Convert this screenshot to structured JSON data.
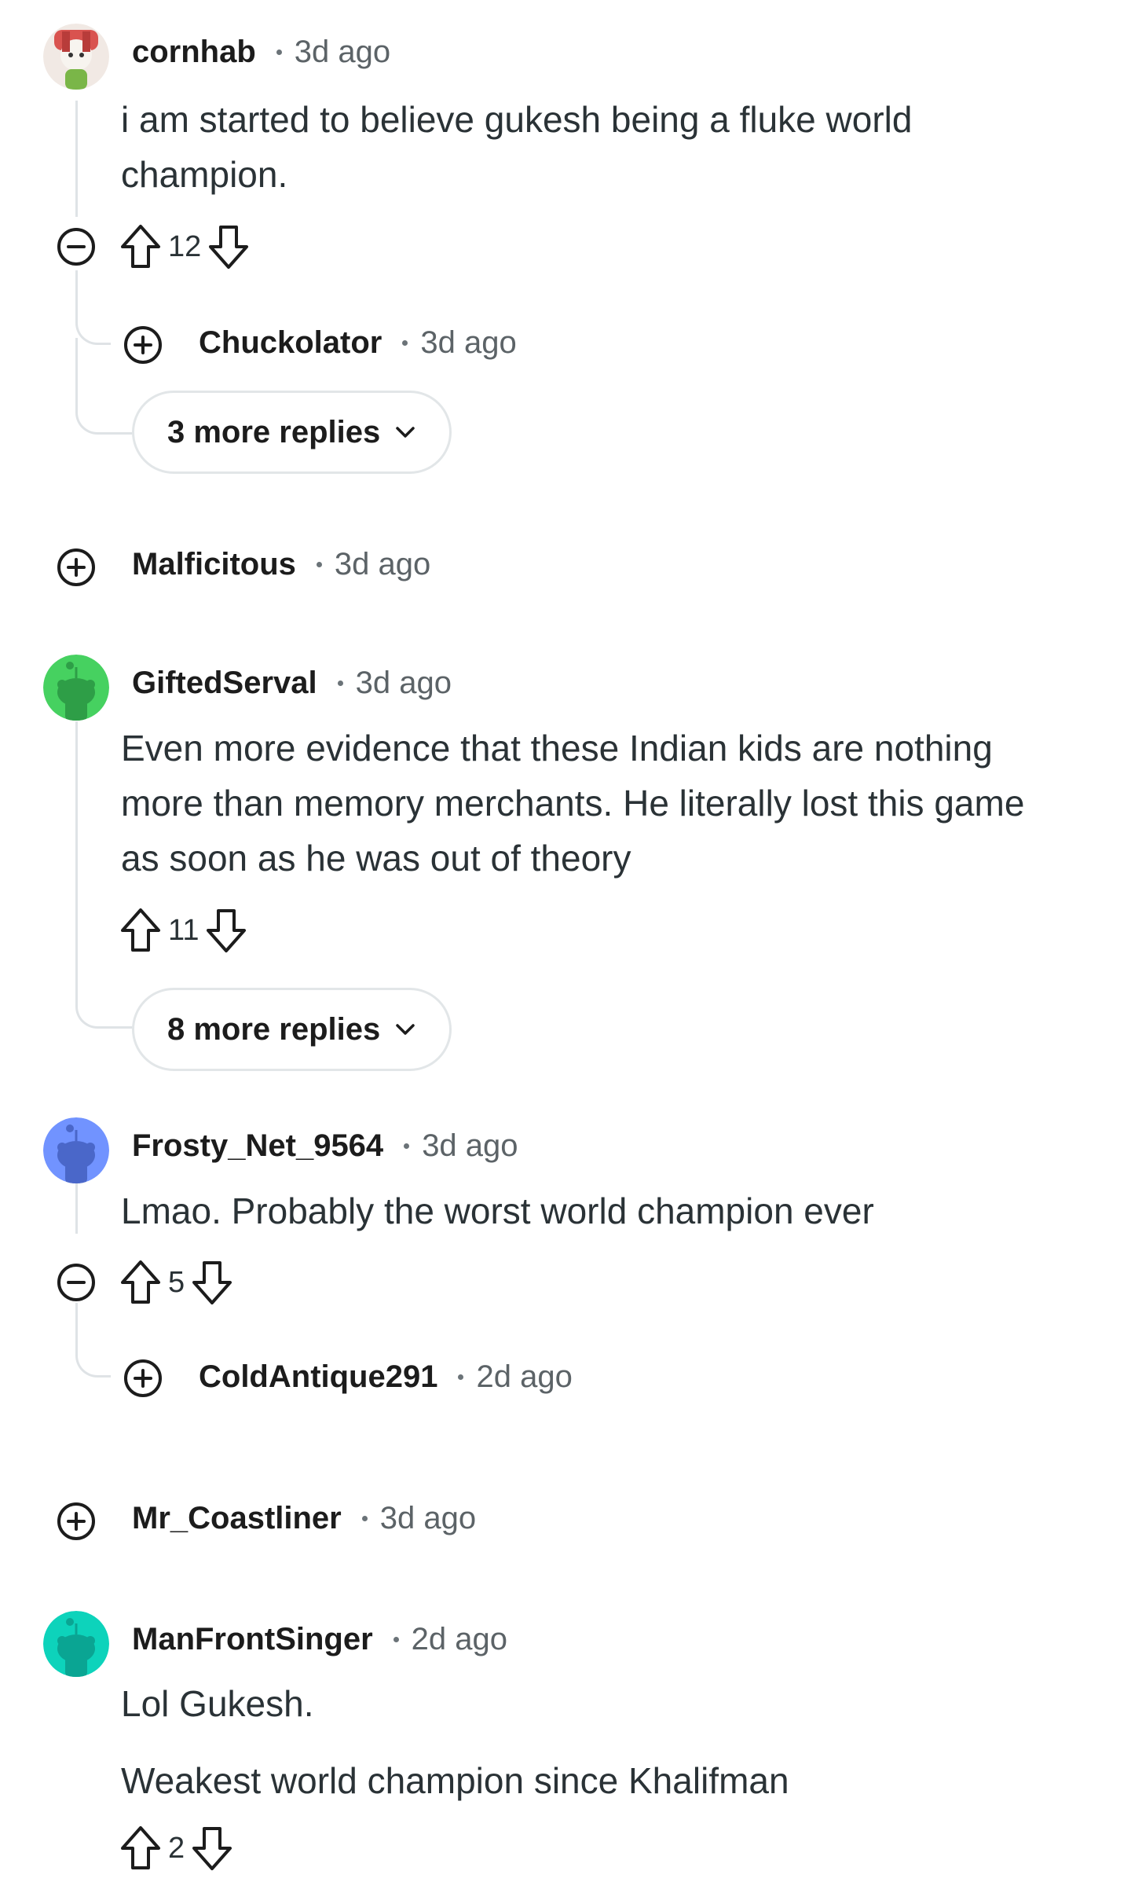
{
  "comments": [
    {
      "user": "cornhab",
      "time": "3d ago",
      "avatar_icon": "snoo-avatar-cornhab",
      "body": [
        "i am started to believe gukesh being a fluke world champion."
      ],
      "votes": "12",
      "replies": [
        {
          "user": "Chuckolator",
          "time": "3d ago",
          "collapsed": true
        }
      ],
      "more_replies_label": "3 more replies"
    },
    {
      "user": "Malficitous",
      "time": "3d ago",
      "collapsed": true
    },
    {
      "user": "GiftedServal",
      "time": "3d ago",
      "avatar_icon": "snoo-avatar-green",
      "body": [
        "Even more evidence that these Indian kids are nothing more than memory merchants. He literally lost this game as soon as he was out of theory"
      ],
      "votes": "11",
      "more_replies_label": "8 more replies"
    },
    {
      "user": "Frosty_Net_9564",
      "time": "3d ago",
      "avatar_icon": "snoo-avatar-blue",
      "body": [
        "Lmao. Probably the worst world champion ever"
      ],
      "votes": "5",
      "replies": [
        {
          "user": "ColdAntique291",
          "time": "2d ago",
          "collapsed": true
        }
      ]
    },
    {
      "user": "Mr_Coastliner",
      "time": "3d ago",
      "collapsed": true
    },
    {
      "user": "ManFrontSinger",
      "time": "2d ago",
      "avatar_icon": "snoo-avatar-teal",
      "body": [
        "Lol Gukesh.",
        "Weakest world champion since Khalifman"
      ],
      "votes": "2"
    }
  ],
  "icons": {
    "upvote": "upvote-arrow-icon",
    "downvote": "downvote-arrow-icon",
    "collapse": "minus-circle-icon",
    "expand": "plus-circle-icon",
    "chevron": "chevron-down-icon"
  },
  "colors": {
    "text": "#1c1c1c",
    "muted": "#5c6367",
    "thread_line": "#dfe3e6",
    "avatar_green": "#46d160",
    "avatar_blue": "#7193ff",
    "avatar_teal": "#0dd3bb"
  }
}
